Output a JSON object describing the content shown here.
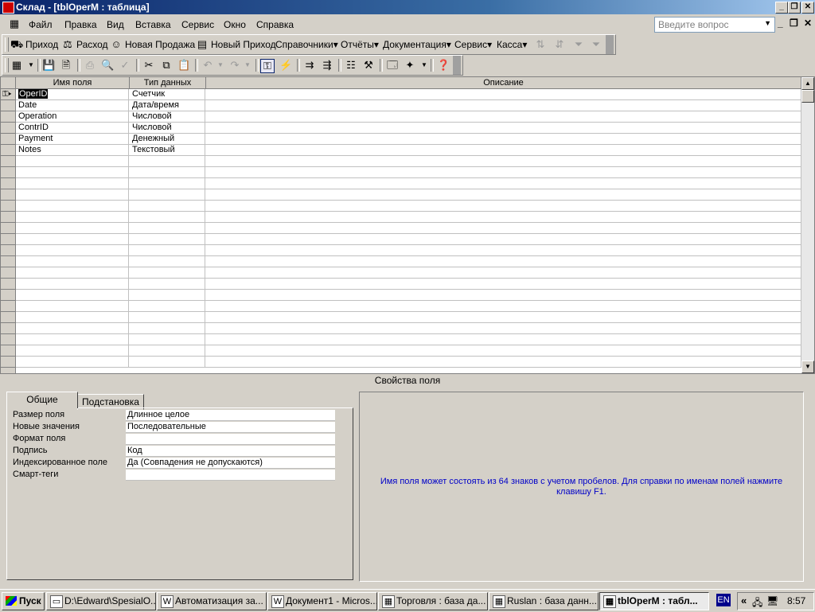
{
  "window": {
    "title": "Склад - [tblOperM : таблица]",
    "btn_min": "_",
    "btn_max": "❐",
    "btn_close": "✕"
  },
  "menu": {
    "items": [
      "Файл",
      "Правка",
      "Вид",
      "Вставка",
      "Сервис",
      "Окно",
      "Справка"
    ],
    "help_placeholder": "Введите вопрос",
    "mdi_min": "_",
    "mdi_max": "❐",
    "mdi_close": "✕"
  },
  "custom_toolbar": {
    "items": [
      "Приход",
      "Расход",
      "Новая Продажа",
      "Новый Приход",
      "Справочники",
      "Отчёты",
      "Документация",
      "Сервис",
      "Касса"
    ],
    "dropdown_marker": "▾"
  },
  "table_design": {
    "headers": [
      "Имя поля",
      "Тип данных",
      "Описание"
    ],
    "rows": [
      {
        "name": "OperID",
        "type": "Счетчик",
        "description": ""
      },
      {
        "name": "Date",
        "type": "Дата/время",
        "description": ""
      },
      {
        "name": "Operation",
        "type": "Числовой",
        "description": ""
      },
      {
        "name": "ContrID",
        "type": "Числовой",
        "description": ""
      },
      {
        "name": "Payment",
        "type": "Денежный",
        "description": ""
      },
      {
        "name": "Notes",
        "type": "Текстовый",
        "description": ""
      }
    ],
    "primary_key_icon": "key-icon"
  },
  "field_properties": {
    "caption": "Свойства поля",
    "tabs": [
      "Общие",
      "Подстановка"
    ],
    "active_tab": "Общие",
    "properties": [
      {
        "label": "Размер поля",
        "value": "Длинное целое"
      },
      {
        "label": "Новые значения",
        "value": "Последовательные"
      },
      {
        "label": "Формат поля",
        "value": ""
      },
      {
        "label": "Подпись",
        "value": "Код"
      },
      {
        "label": "Индексированное поле",
        "value": "Да (Совпадения не допускаются)"
      },
      {
        "label": "Смарт-теги",
        "value": ""
      }
    ],
    "help_text": "Имя поля может состоять из 64 знаков с учетом пробелов.  Для справки по именам полей нажмите клавишу F1.",
    "help_text_color": "#0000c8"
  },
  "taskbar": {
    "start_label": "Пуск",
    "tasks": [
      {
        "label": "D:\\Edward\\SpesialO...",
        "active": false
      },
      {
        "label": "Автоматизация за...",
        "active": false
      },
      {
        "label": "Документ1 - Micros...",
        "active": false
      },
      {
        "label": "Торговля : база да...",
        "active": false
      },
      {
        "label": "Ruslan : база данн...",
        "active": false
      },
      {
        "label": "tblOperM : табл...",
        "active": true
      }
    ],
    "language": "EN",
    "tray_arrows": "«",
    "clock": "8:57"
  }
}
